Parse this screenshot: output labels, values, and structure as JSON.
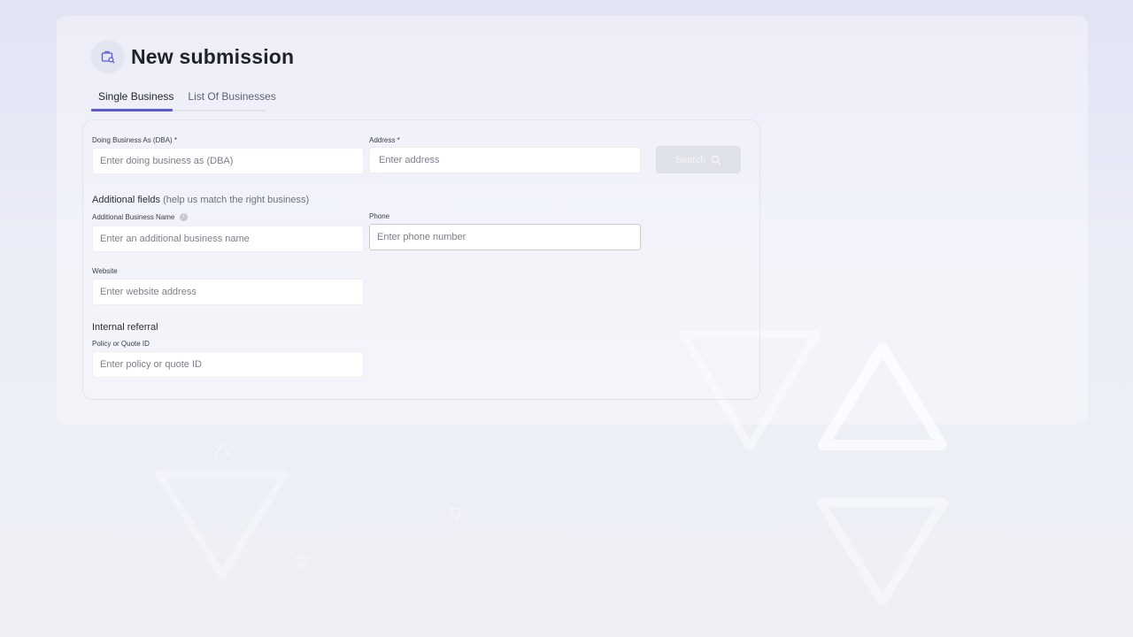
{
  "header": {
    "title": "New submission",
    "icon": "briefcase-search-icon"
  },
  "tabs": [
    {
      "label": "Single Business",
      "active": true
    },
    {
      "label": "List Of Businesses",
      "active": false
    }
  ],
  "form": {
    "dba": {
      "label": "Doing Business As (DBA) *",
      "placeholder": "Enter doing business as (DBA)",
      "value": ""
    },
    "address": {
      "label": "Address *",
      "placeholder": "Enter address",
      "value": ""
    },
    "search_button": {
      "label": "Search",
      "icon": "search-icon",
      "enabled": false
    },
    "additional": {
      "heading": "Additional fields",
      "hint": "(help us match the right business)",
      "business_name": {
        "label": "Additional Business Name",
        "placeholder": "Enter an additional business name",
        "info_icon": "info-icon"
      },
      "phone": {
        "label": "Phone",
        "placeholder": "Enter phone number"
      },
      "website": {
        "label": "Website",
        "placeholder": "Enter website address"
      }
    },
    "internal": {
      "heading": "Internal referral",
      "policy": {
        "label": "Policy or Quote ID",
        "placeholder": "Enter policy or quote ID"
      }
    }
  },
  "colors": {
    "accent": "#5b59d6",
    "background": "#e4e5f5",
    "disabled_button": "#dfe1e8"
  }
}
